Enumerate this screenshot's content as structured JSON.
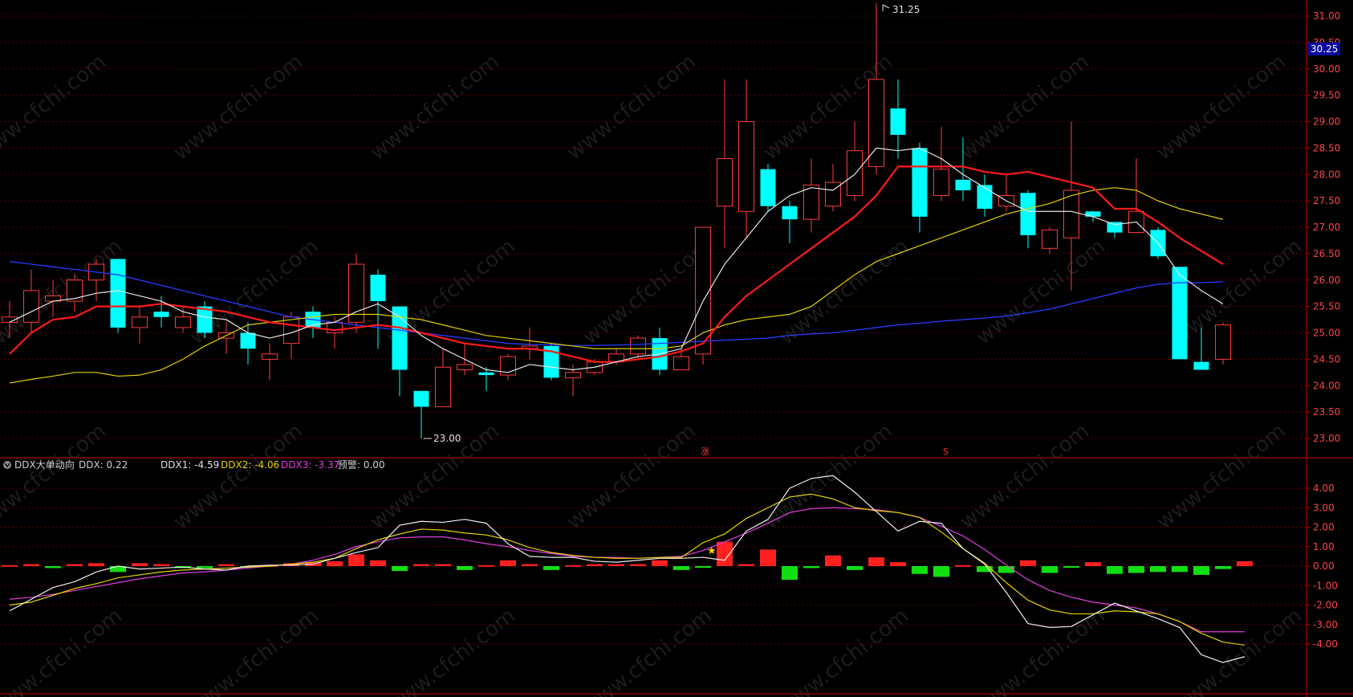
{
  "colors": {
    "bg": "#000000",
    "grid": "#5a0000",
    "axis": "#c00000",
    "axis_text": "#ff4444",
    "up": "#ff3b3b",
    "down": "#00ffff",
    "ma_white": "#e6e6e6",
    "ma_red": "#ff1a1a",
    "ma_yellow": "#e0d000",
    "ma_blue": "#2a3cff",
    "ddx_white": "#f0f0f0",
    "ddx_yellow": "#e6d400",
    "ddx_magenta": "#e040e0",
    "bar_up": "#ff2020",
    "bar_down": "#10e010",
    "price_tag_bg": "#0a0aa0"
  },
  "watermark": "www.cfchi.com",
  "main_chart": {
    "y_axis_ticks": [
      "31.00",
      "30.50",
      "30.00",
      "29.50",
      "29.00",
      "28.50",
      "28.00",
      "27.50",
      "27.00",
      "26.50",
      "26.00",
      "25.50",
      "25.00",
      "24.50",
      "24.00",
      "23.50",
      "23.00"
    ],
    "ylim": [
      22.75,
      31.25
    ],
    "current_price_tag": "30.25",
    "high_label": "31.25",
    "low_label": "23.00",
    "markers": [
      "涨",
      "S"
    ],
    "candles": [
      {
        "o": 25.2,
        "h": 25.6,
        "l": 24.9,
        "c": 25.3
      },
      {
        "o": 25.2,
        "h": 26.2,
        "l": 25.0,
        "c": 25.8
      },
      {
        "o": 25.6,
        "h": 26.0,
        "l": 25.3,
        "c": 25.7
      },
      {
        "o": 25.6,
        "h": 26.1,
        "l": 25.4,
        "c": 26.0
      },
      {
        "o": 26.0,
        "h": 26.4,
        "l": 25.6,
        "c": 26.3
      },
      {
        "o": 26.4,
        "h": 26.4,
        "l": 25.0,
        "c": 25.1
      },
      {
        "o": 25.1,
        "h": 25.5,
        "l": 24.8,
        "c": 25.3
      },
      {
        "o": 25.4,
        "h": 25.7,
        "l": 25.1,
        "c": 25.3
      },
      {
        "o": 25.1,
        "h": 25.5,
        "l": 25.0,
        "c": 25.3
      },
      {
        "o": 25.5,
        "h": 25.6,
        "l": 24.9,
        "c": 25.0
      },
      {
        "o": 24.9,
        "h": 25.2,
        "l": 24.6,
        "c": 25.0
      },
      {
        "o": 25.0,
        "h": 25.2,
        "l": 24.4,
        "c": 24.7
      },
      {
        "o": 24.5,
        "h": 24.8,
        "l": 24.1,
        "c": 24.6
      },
      {
        "o": 24.8,
        "h": 25.4,
        "l": 24.5,
        "c": 25.3
      },
      {
        "o": 25.4,
        "h": 25.5,
        "l": 24.9,
        "c": 25.1
      },
      {
        "o": 25.0,
        "h": 25.3,
        "l": 24.7,
        "c": 25.2
      },
      {
        "o": 25.2,
        "h": 26.5,
        "l": 25.0,
        "c": 26.3
      },
      {
        "o": 26.1,
        "h": 26.2,
        "l": 24.7,
        "c": 25.6
      },
      {
        "o": 25.5,
        "h": 25.5,
        "l": 23.8,
        "c": 24.3
      },
      {
        "o": 23.9,
        "h": 23.9,
        "l": 23.0,
        "c": 23.6
      },
      {
        "o": 23.6,
        "h": 24.7,
        "l": 23.6,
        "c": 24.35
      },
      {
        "o": 24.3,
        "h": 24.8,
        "l": 24.2,
        "c": 24.4
      },
      {
        "o": 24.25,
        "h": 24.35,
        "l": 23.9,
        "c": 24.2
      },
      {
        "o": 24.2,
        "h": 24.6,
        "l": 24.1,
        "c": 24.55
      },
      {
        "o": 24.7,
        "h": 25.1,
        "l": 24.5,
        "c": 24.75
      },
      {
        "o": 24.75,
        "h": 24.8,
        "l": 24.1,
        "c": 24.15
      },
      {
        "o": 24.15,
        "h": 24.4,
        "l": 23.8,
        "c": 24.25
      },
      {
        "o": 24.25,
        "h": 24.5,
        "l": 24.2,
        "c": 24.45
      },
      {
        "o": 24.45,
        "h": 24.7,
        "l": 24.4,
        "c": 24.6
      },
      {
        "o": 24.6,
        "h": 24.95,
        "l": 24.5,
        "c": 24.9
      },
      {
        "o": 24.9,
        "h": 25.1,
        "l": 24.2,
        "c": 24.3
      },
      {
        "o": 24.3,
        "h": 24.7,
        "l": 24.3,
        "c": 24.55
      },
      {
        "o": 24.6,
        "h": 27.0,
        "l": 24.4,
        "c": 27.0
      },
      {
        "o": 27.4,
        "h": 29.8,
        "l": 26.6,
        "c": 28.3
      },
      {
        "o": 27.3,
        "h": 29.8,
        "l": 26.8,
        "c": 29.0
      },
      {
        "o": 28.1,
        "h": 28.2,
        "l": 27.3,
        "c": 27.4
      },
      {
        "o": 27.4,
        "h": 27.5,
        "l": 26.7,
        "c": 27.15
      },
      {
        "o": 27.15,
        "h": 28.3,
        "l": 26.9,
        "c": 27.8
      },
      {
        "o": 27.4,
        "h": 28.2,
        "l": 27.3,
        "c": 27.85
      },
      {
        "o": 27.6,
        "h": 29.0,
        "l": 27.5,
        "c": 28.45
      },
      {
        "o": 28.15,
        "h": 31.25,
        "l": 28.0,
        "c": 29.8
      },
      {
        "o": 29.25,
        "h": 29.8,
        "l": 28.3,
        "c": 28.75
      },
      {
        "o": 28.5,
        "h": 28.6,
        "l": 26.9,
        "c": 27.2
      },
      {
        "o": 27.6,
        "h": 28.9,
        "l": 27.5,
        "c": 28.1
      },
      {
        "o": 27.9,
        "h": 28.7,
        "l": 27.5,
        "c": 27.7
      },
      {
        "o": 27.8,
        "h": 28.0,
        "l": 27.2,
        "c": 27.35
      },
      {
        "o": 27.4,
        "h": 28.0,
        "l": 27.3,
        "c": 27.6
      },
      {
        "o": 27.65,
        "h": 27.7,
        "l": 26.6,
        "c": 26.85
      },
      {
        "o": 26.6,
        "h": 27.0,
        "l": 26.5,
        "c": 26.95
      },
      {
        "o": 26.8,
        "h": 29.0,
        "l": 25.8,
        "c": 27.7
      },
      {
        "o": 27.3,
        "h": 27.3,
        "l": 27.1,
        "c": 27.2
      },
      {
        "o": 27.1,
        "h": 27.1,
        "l": 26.8,
        "c": 26.9
      },
      {
        "o": 26.9,
        "h": 28.3,
        "l": 26.9,
        "c": 27.3
      },
      {
        "o": 26.95,
        "h": 27.0,
        "l": 26.4,
        "c": 26.45
      },
      {
        "o": 26.25,
        "h": 26.25,
        "l": 24.5,
        "c": 24.5
      },
      {
        "o": 24.45,
        "h": 25.1,
        "l": 24.3,
        "c": 24.3
      },
      {
        "o": 24.5,
        "h": 25.2,
        "l": 24.4,
        "c": 25.15
      }
    ],
    "ma_white": [
      25.2,
      25.4,
      25.6,
      25.65,
      25.75,
      25.8,
      25.7,
      25.6,
      25.4,
      25.3,
      25.25,
      25.0,
      24.9,
      25.0,
      25.15,
      25.2,
      25.4,
      25.55,
      25.3,
      24.95,
      24.7,
      24.5,
      24.3,
      24.25,
      24.4,
      24.35,
      24.3,
      24.35,
      24.45,
      24.55,
      24.6,
      24.7,
      25.6,
      26.3,
      26.8,
      27.3,
      27.6,
      27.75,
      27.7,
      28.0,
      28.5,
      28.45,
      28.5,
      28.3,
      28.0,
      27.75,
      27.5,
      27.3,
      27.3,
      27.3,
      27.2,
      27.05,
      27.1,
      26.7,
      26.1,
      25.8,
      25.55
    ],
    "ma_red": [
      24.6,
      25.0,
      25.25,
      25.3,
      25.5,
      25.5,
      25.5,
      25.55,
      25.5,
      25.45,
      25.4,
      25.3,
      25.2,
      25.15,
      25.1,
      25.05,
      25.1,
      25.15,
      25.1,
      25.0,
      24.9,
      24.8,
      24.75,
      24.7,
      24.7,
      24.65,
      24.55,
      24.45,
      24.45,
      24.5,
      24.55,
      24.65,
      24.8,
      25.3,
      25.7,
      26.0,
      26.3,
      26.6,
      26.9,
      27.2,
      27.6,
      28.15,
      28.15,
      28.15,
      28.15,
      28.05,
      28.0,
      28.05,
      27.95,
      27.85,
      27.75,
      27.35,
      27.35,
      27.1,
      26.8,
      26.55,
      26.3
    ],
    "ma_yellow": [
      24.05,
      24.12,
      24.18,
      24.25,
      24.25,
      24.18,
      24.2,
      24.3,
      24.5,
      24.75,
      24.95,
      25.15,
      25.2,
      25.25,
      25.3,
      25.35,
      25.35,
      25.35,
      25.3,
      25.25,
      25.15,
      25.05,
      24.95,
      24.9,
      24.85,
      24.8,
      24.75,
      24.7,
      24.7,
      24.7,
      24.7,
      24.75,
      25.0,
      25.15,
      25.25,
      25.3,
      25.35,
      25.5,
      25.8,
      26.1,
      26.35,
      26.5,
      26.65,
      26.8,
      26.95,
      27.1,
      27.25,
      27.35,
      27.45,
      27.6,
      27.7,
      27.75,
      27.7,
      27.5,
      27.35,
      27.25,
      27.15
    ],
    "ma_blue": [
      26.35,
      26.3,
      26.25,
      26.2,
      26.15,
      26.1,
      26.0,
      25.9,
      25.8,
      25.7,
      25.6,
      25.5,
      25.4,
      25.3,
      25.25,
      25.2,
      25.15,
      25.1,
      25.05,
      25.0,
      24.95,
      24.9,
      24.85,
      24.8,
      24.78,
      24.77,
      24.76,
      24.76,
      24.77,
      24.78,
      24.8,
      24.82,
      24.84,
      24.86,
      24.88,
      24.9,
      24.95,
      24.98,
      25.0,
      25.05,
      25.1,
      25.15,
      25.18,
      25.22,
      25.25,
      25.28,
      25.32,
      25.38,
      25.45,
      25.55,
      25.65,
      25.75,
      25.85,
      25.92,
      25.95,
      25.95,
      25.97
    ]
  },
  "ddx_panel": {
    "title": "DDX大单动向",
    "ddx_label": "DDX: 0.22",
    "ddx1_label": "DDX1: -4.59",
    "ddx2_label": "DDX2: -4.06",
    "ddx3_label": "DDX3: -3.37",
    "warn_label": "预警: 0.00",
    "y_axis_ticks": [
      "4.00",
      "3.00",
      "2.00",
      "1.00",
      "0.00",
      "-1.00",
      "-2.00",
      "-3.00",
      "-4.00"
    ],
    "ylim": [
      -5.0,
      5.0
    ],
    "bars": [
      0.05,
      0.1,
      -0.1,
      0.1,
      0.15,
      -0.3,
      0.15,
      0.1,
      -0.1,
      -0.1,
      0.1,
      -0.05,
      0.05,
      0.15,
      0.2,
      0.25,
      0.6,
      0.3,
      -0.25,
      0.1,
      0.1,
      -0.2,
      0.05,
      0.3,
      0.1,
      -0.2,
      0.05,
      0.1,
      0.1,
      0.1,
      0.3,
      -0.2,
      -0.05,
      1.25,
      0.1,
      0.85,
      -0.7,
      -0.1,
      0.55,
      -0.2,
      0.45,
      0.2,
      -0.4,
      -0.55,
      0.05,
      -0.3,
      -0.35,
      0.3,
      -0.35,
      -0.05,
      0.2,
      -0.4,
      -0.35,
      -0.3,
      -0.3,
      -0.45,
      -0.15,
      0.25
    ],
    "line_white": [
      -2.3,
      -1.7,
      -1.1,
      -0.8,
      -0.3,
      0.0,
      -0.15,
      -0.1,
      -0.05,
      -0.15,
      -0.2,
      0.0,
      0.05,
      0.05,
      0.1,
      0.4,
      0.7,
      0.95,
      2.1,
      2.3,
      2.25,
      2.4,
      2.2,
      1.15,
      0.5,
      0.45,
      0.45,
      0.25,
      0.2,
      0.3,
      0.4,
      0.4,
      0.45,
      0.3,
      1.8,
      2.4,
      4.0,
      4.5,
      4.65,
      3.8,
      2.8,
      1.8,
      2.3,
      2.2,
      0.9,
      0.1,
      -1.35,
      -2.95,
      -3.15,
      -3.1,
      -2.5,
      -1.9,
      -2.3,
      -2.7,
      -3.15,
      -4.55,
      -4.95,
      -4.65
    ],
    "line_yellow": [
      -2.0,
      -1.85,
      -1.5,
      -1.15,
      -0.9,
      -0.6,
      -0.45,
      -0.3,
      -0.2,
      -0.15,
      -0.1,
      -0.05,
      0.0,
      0.1,
      0.2,
      0.4,
      0.9,
      1.35,
      1.65,
      1.9,
      1.85,
      1.7,
      1.6,
      1.35,
      0.95,
      0.7,
      0.55,
      0.45,
      0.4,
      0.4,
      0.45,
      0.45,
      1.2,
      1.65,
      2.45,
      3.0,
      3.55,
      3.7,
      3.45,
      3.0,
      2.85,
      2.75,
      2.5,
      1.75,
      0.9,
      0.15,
      -0.85,
      -1.75,
      -2.25,
      -2.45,
      -2.45,
      -2.3,
      -2.35,
      -2.45,
      -2.85,
      -3.45,
      -3.9,
      -4.06
    ],
    "line_magenta": [
      -1.7,
      -1.6,
      -1.45,
      -1.25,
      -1.05,
      -0.85,
      -0.65,
      -0.5,
      -0.35,
      -0.3,
      -0.2,
      -0.1,
      0.0,
      0.1,
      0.3,
      0.6,
      1.0,
      1.25,
      1.45,
      1.5,
      1.5,
      1.35,
      1.15,
      1.0,
      0.8,
      0.65,
      0.5,
      0.45,
      0.45,
      0.4,
      0.45,
      0.5,
      0.8,
      1.25,
      1.7,
      2.2,
      2.75,
      2.95,
      3.0,
      2.95,
      2.9,
      2.75,
      2.5,
      2.05,
      1.55,
      0.85,
      0.05,
      -0.7,
      -1.25,
      -1.6,
      -1.85,
      -2.0,
      -2.15,
      -2.45,
      -2.85,
      -3.37,
      -3.37,
      -3.37
    ]
  }
}
